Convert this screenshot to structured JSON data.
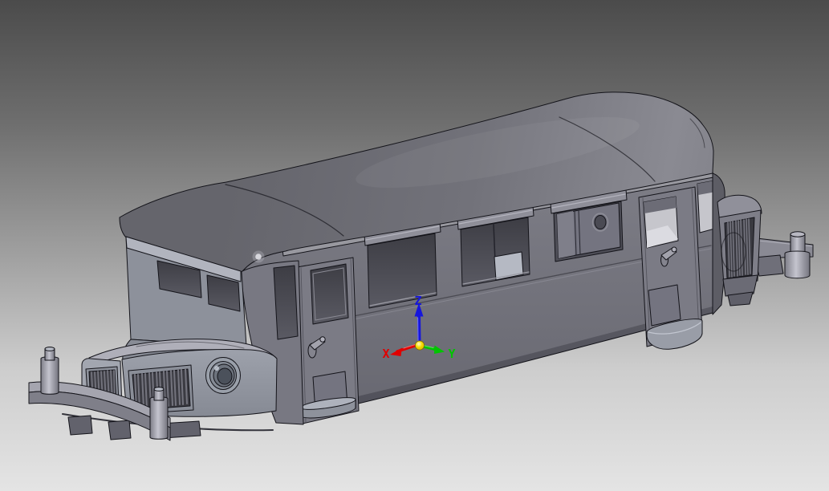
{
  "viewport": {
    "background_top_color": "#4b4b4b",
    "background_bottom_color": "#e4e4e4"
  },
  "model": {
    "body_color": "#75757e",
    "edge_color": "#14141a",
    "window_color": "#45454d",
    "lit_window_color": "#c6c6cc",
    "grille_color": "#3b3b42"
  },
  "triad": {
    "origin_ball_color": "#f2d400",
    "axes": [
      {
        "label": "X",
        "color": "#e00000"
      },
      {
        "label": "Y",
        "color": "#00c400"
      },
      {
        "label": "Z",
        "color": "#1616dc"
      }
    ]
  }
}
